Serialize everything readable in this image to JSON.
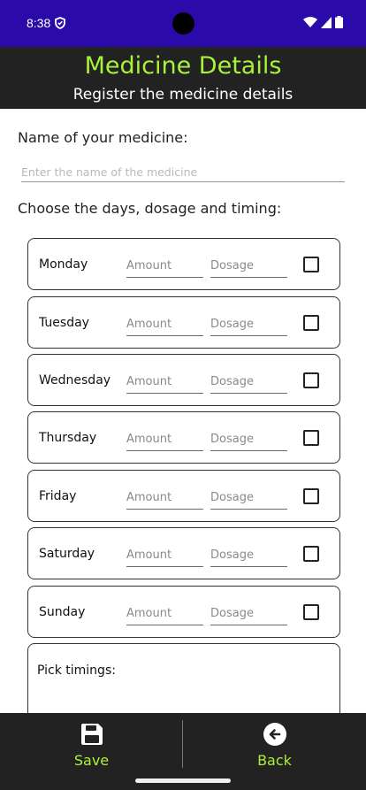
{
  "status_bar": {
    "time": "8:38"
  },
  "header": {
    "title": "Medicine Details",
    "subtitle": "Register the medicine details"
  },
  "form": {
    "name_label": "Name of your medicine:",
    "name_placeholder": "Enter the name of the medicine",
    "name_value": "",
    "schedule_label": "Choose the days, dosage and timing:",
    "amount_placeholder": "Amount",
    "dosage_placeholder": "Dosage",
    "days": [
      {
        "name": "Monday",
        "checked": false
      },
      {
        "name": "Tuesday",
        "checked": false
      },
      {
        "name": "Wednesday",
        "checked": false
      },
      {
        "name": "Thursday",
        "checked": false
      },
      {
        "name": "Friday",
        "checked": false
      },
      {
        "name": "Saturday",
        "checked": false
      },
      {
        "name": "Sunday",
        "checked": false
      }
    ],
    "timings_label": "Pick timings:"
  },
  "bottom_bar": {
    "save_label": "Save",
    "save_icon": "floppy-disk-icon",
    "back_label": "Back",
    "back_icon": "arrow-left-circle-icon",
    "accent_color": "#a9f23a"
  },
  "colors": {
    "status_bar": "#2a0aa8",
    "header_bg": "#222222",
    "title": "#a9f23a"
  }
}
